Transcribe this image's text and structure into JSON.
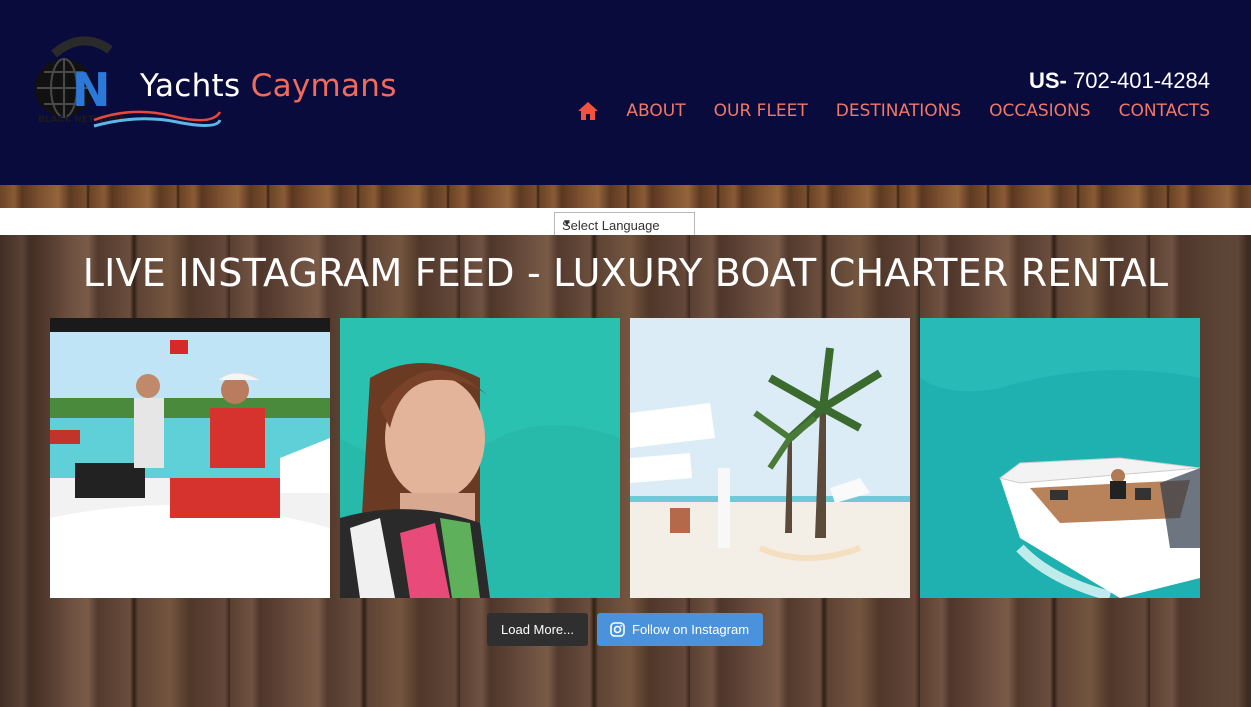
{
  "header": {
    "logo": {
      "word1": "Yachts",
      "word2": "Caymans",
      "mark_text": "BLACK NETWORK"
    },
    "phone": {
      "prefix": "US-",
      "number": "702-401-4284"
    },
    "nav": {
      "home_icon": "home-icon",
      "items": [
        "ABOUT",
        "OUR FLEET",
        "DESTINATIONS",
        "OCCASIONS",
        "CONTACTS"
      ]
    }
  },
  "language": {
    "selected": "Select Language"
  },
  "feed": {
    "title": "LIVE INSTAGRAM FEED - LUXURY BOAT CHARTER RENTAL",
    "load_more_label": "Load More...",
    "follow_label": "Follow on Instagram",
    "follow_icon": "instagram-icon"
  },
  "colors": {
    "header_bg": "#0a0b3d",
    "nav_text": "#f07868",
    "follow_button": "#4a92db",
    "load_button": "#2f2f2f"
  }
}
